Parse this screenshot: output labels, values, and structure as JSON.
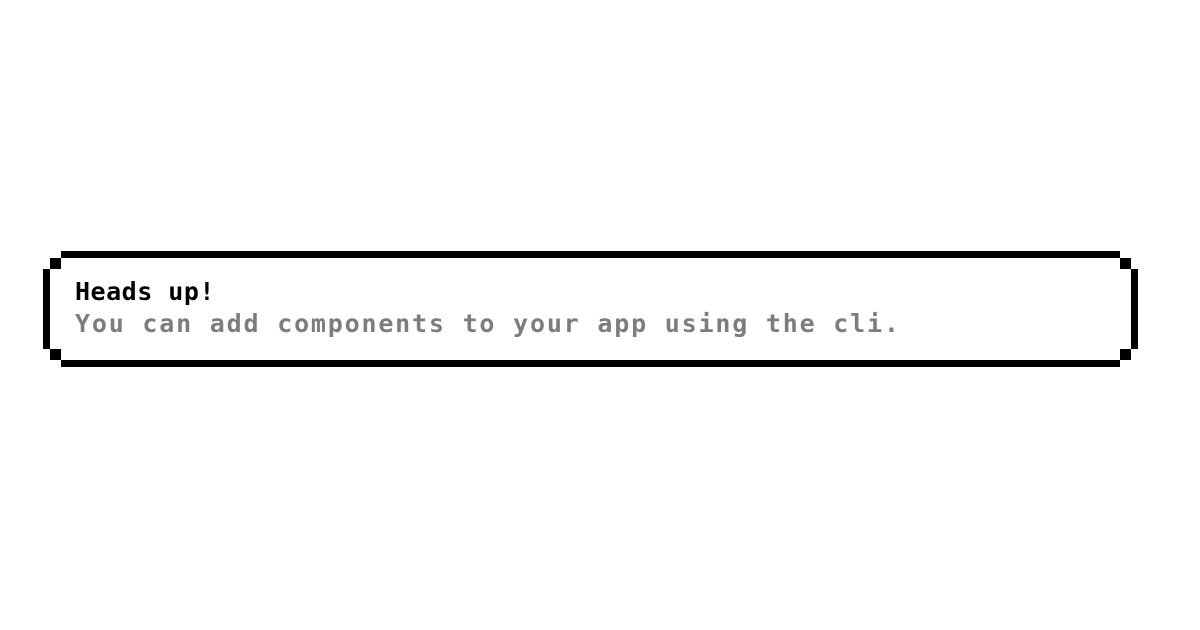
{
  "alert": {
    "title": "Heads up!",
    "description": "You can add components to your app using the cli."
  },
  "colors": {
    "background": "#ffffff",
    "border": "#000000",
    "title": "#000000",
    "description": "#7d7d7d"
  }
}
